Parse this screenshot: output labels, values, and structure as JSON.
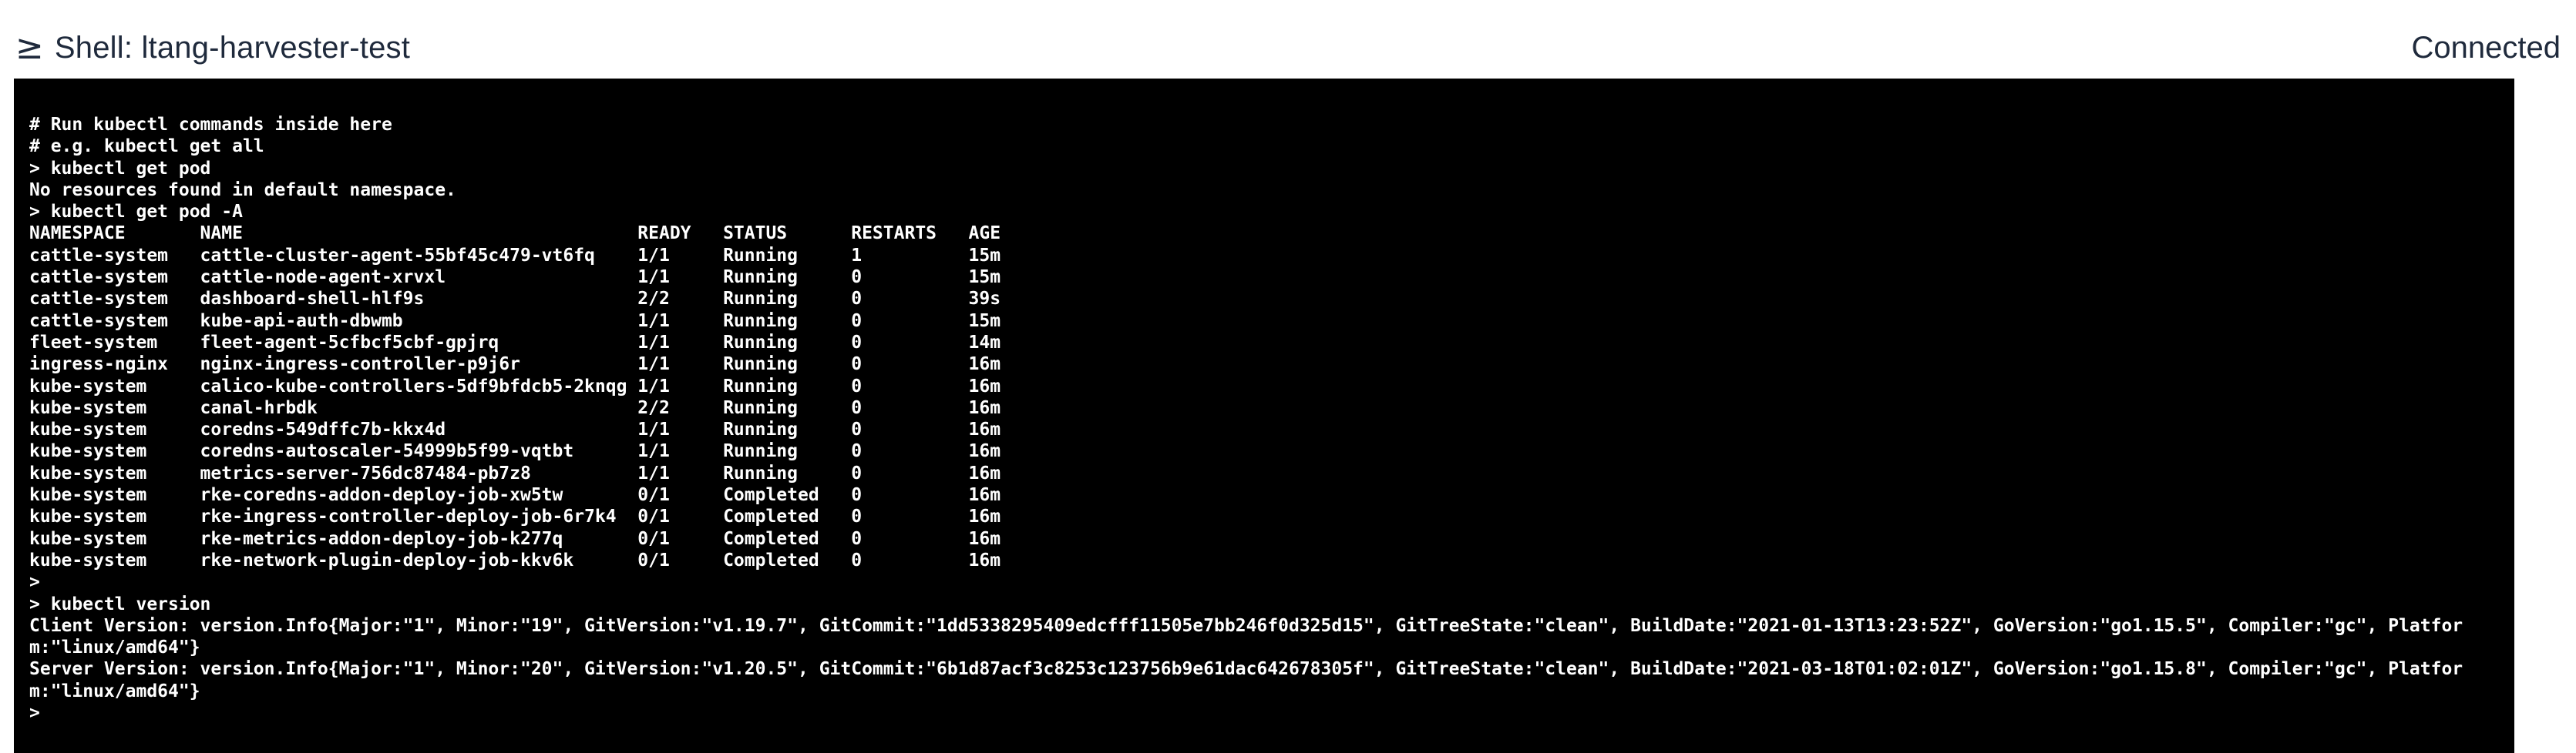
{
  "header": {
    "icon": "terminal-prompt-icon",
    "icon_glyph": "≥",
    "title": "Shell: ltang-harvester-test",
    "status": "Connected"
  },
  "terminal": {
    "lines": [
      "# Run kubectl commands inside here",
      "# e.g. kubectl get all",
      "> kubectl get pod",
      "No resources found in default namespace.",
      "> kubectl get pod -A",
      "NAMESPACE       NAME                                     READY   STATUS      RESTARTS   AGE",
      "cattle-system   cattle-cluster-agent-55bf45c479-vt6fq    1/1     Running     1          15m",
      "cattle-system   cattle-node-agent-xrvxl                  1/1     Running     0          15m",
      "cattle-system   dashboard-shell-hlf9s                    2/2     Running     0          39s",
      "cattle-system   kube-api-auth-dbwmb                      1/1     Running     0          15m",
      "fleet-system    fleet-agent-5cfbcf5cbf-gpjrq             1/1     Running     0          14m",
      "ingress-nginx   nginx-ingress-controller-p9j6r           1/1     Running     0          16m",
      "kube-system     calico-kube-controllers-5df9bfdcb5-2knqg 1/1     Running     0          16m",
      "kube-system     canal-hrbdk                              2/2     Running     0          16m",
      "kube-system     coredns-549dffc7b-kkx4d                  1/1     Running     0          16m",
      "kube-system     coredns-autoscaler-54999b5f99-vqtbt      1/1     Running     0          16m",
      "kube-system     metrics-server-756dc87484-pb7z8          1/1     Running     0          16m",
      "kube-system     rke-coredns-addon-deploy-job-xw5tw       0/1     Completed   0          16m",
      "kube-system     rke-ingress-controller-deploy-job-6r7k4  0/1     Completed   0          16m",
      "kube-system     rke-metrics-addon-deploy-job-k277q       0/1     Completed   0          16m",
      "kube-system     rke-network-plugin-deploy-job-kkv6k      0/1     Completed   0          16m",
      ">",
      "> kubectl version",
      "Client Version: version.Info{Major:\"1\", Minor:\"19\", GitVersion:\"v1.19.7\", GitCommit:\"1dd5338295409edcfff11505e7bb246f0d325d15\", GitTreeState:\"clean\", BuildDate:\"2021-01-13T13:23:52Z\", GoVersion:\"go1.15.5\", Compiler:\"gc\", Platfor",
      "m:\"linux/amd64\"}",
      "Server Version: version.Info{Major:\"1\", Minor:\"20\", GitVersion:\"v1.20.5\", GitCommit:\"6b1d87acf3c8253c123756b9e61dac642678305f\", GitTreeState:\"clean\", BuildDate:\"2021-03-18T01:02:01Z\", GoVersion:\"go1.15.8\", Compiler:\"gc\", Platfor",
      "m:\"linux/amd64\"}"
    ],
    "prompt": ">",
    "colors": {
      "background": "#000000",
      "foreground": "#ffffff"
    }
  }
}
